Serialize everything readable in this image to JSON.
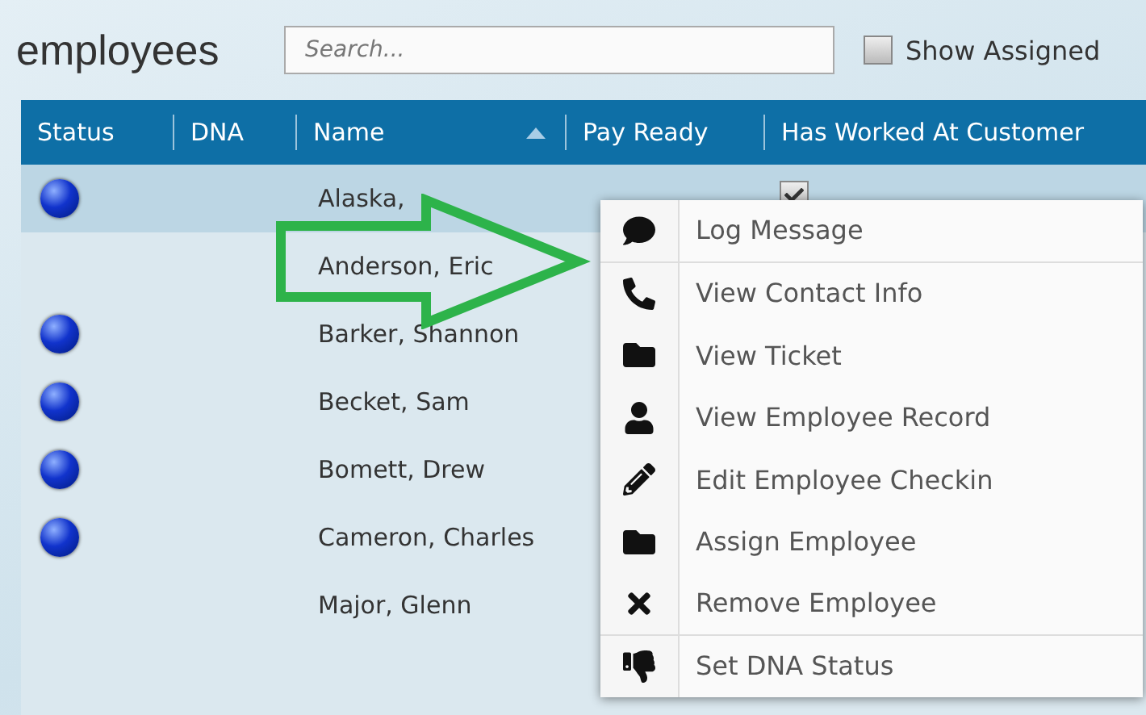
{
  "title": "employees",
  "search": {
    "placeholder": "Search..."
  },
  "show_assigned": {
    "label": "Show Assigned",
    "checked": false
  },
  "columns": [
    {
      "label": "Status",
      "sorted": false
    },
    {
      "label": "DNA",
      "sorted": false
    },
    {
      "label": "Name",
      "sorted": true
    },
    {
      "label": "Pay Ready",
      "sorted": false
    },
    {
      "label": "Has Worked At Customer",
      "sorted": false
    }
  ],
  "rows": [
    {
      "name": "Alaska,",
      "status_dot": true,
      "selected": true,
      "has_worked": true
    },
    {
      "name": "Anderson, Eric",
      "status_dot": false,
      "selected": false
    },
    {
      "name": "Barker, Shannon",
      "status_dot": true,
      "selected": false
    },
    {
      "name": "Becket, Sam",
      "status_dot": true,
      "selected": false
    },
    {
      "name": "Bomett, Drew",
      "status_dot": true,
      "selected": false
    },
    {
      "name": "Cameron, Charles",
      "status_dot": true,
      "selected": false
    },
    {
      "name": "Major, Glenn",
      "status_dot": false,
      "selected": false
    }
  ],
  "context_menu": {
    "items": [
      {
        "label": "Log Message",
        "kind": "comment",
        "divider_after": true
      },
      {
        "label": "View Contact Info",
        "kind": "phone",
        "divider_after": false
      },
      {
        "label": "View Ticket",
        "kind": "folder",
        "divider_after": false
      },
      {
        "label": "View Employee Record",
        "kind": "user",
        "divider_after": false
      },
      {
        "label": "Edit Employee Checkin",
        "kind": "pencil",
        "divider_after": false
      },
      {
        "label": "Assign Employee",
        "kind": "folder",
        "divider_after": false
      },
      {
        "label": "Remove Employee",
        "kind": "remove",
        "divider_after": true
      },
      {
        "label": "Set DNA Status",
        "kind": "thumbsdown",
        "divider_after": false
      }
    ]
  }
}
